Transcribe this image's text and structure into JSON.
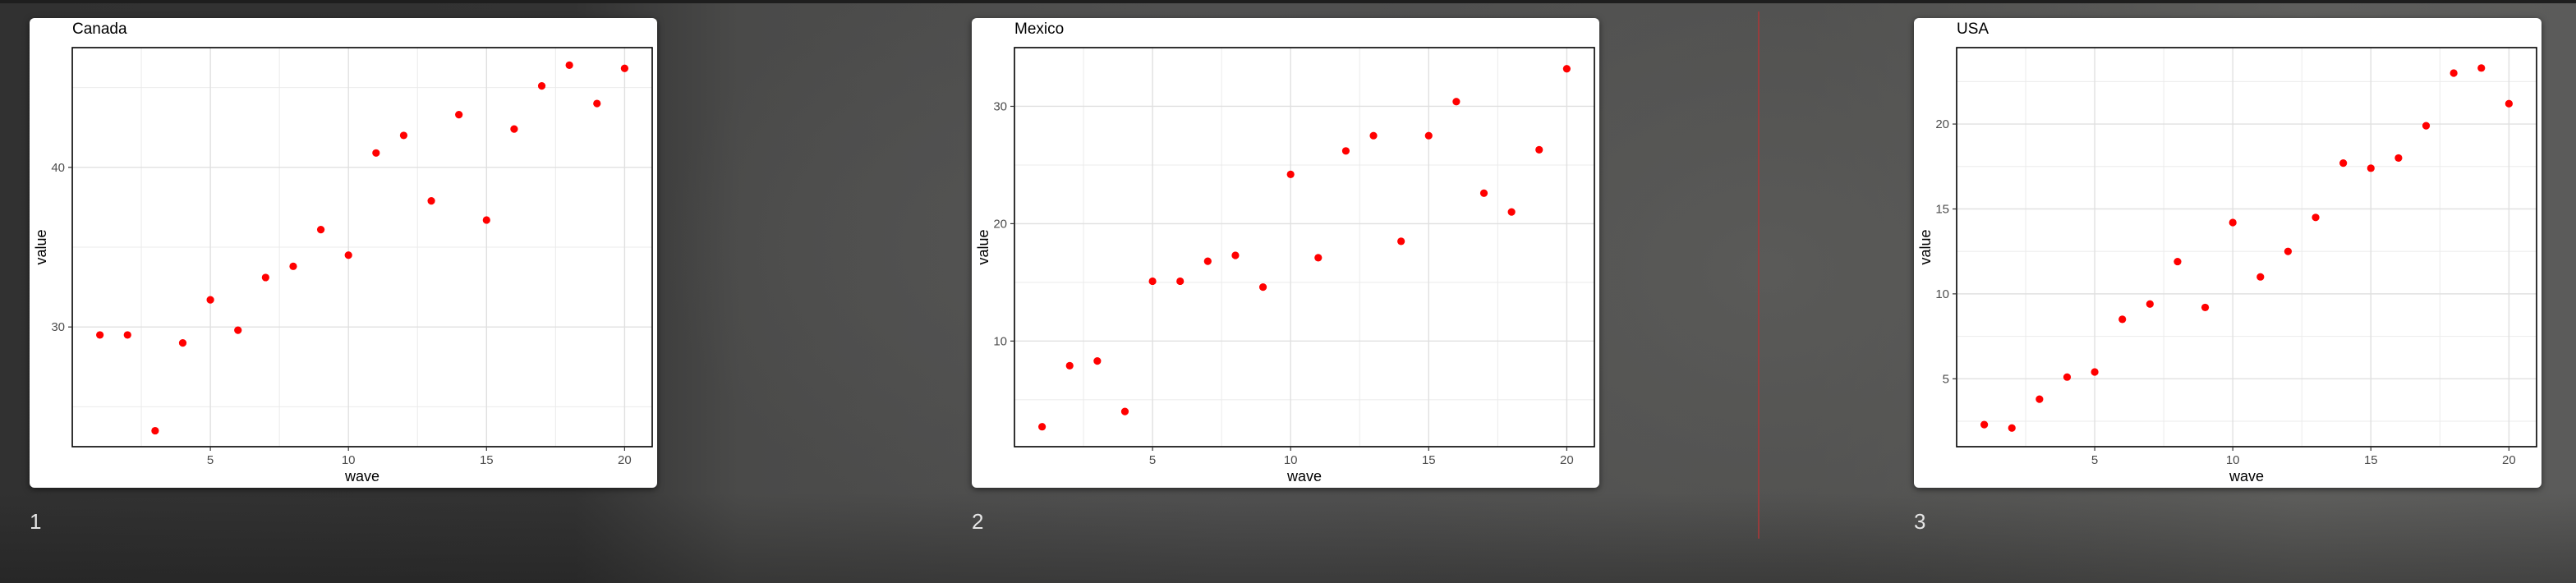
{
  "pages": [
    "1",
    "2",
    "3"
  ],
  "colors": {
    "point": "#ff0000",
    "grid": "#ebebeb",
    "frame": "#000000"
  },
  "chart_data": [
    {
      "type": "scatter",
      "title": "Canada",
      "xlabel": "wave",
      "ylabel": "value",
      "xlim": [
        0,
        21
      ],
      "ylim": [
        22.5,
        47.5
      ],
      "xticks": [
        5,
        10,
        15,
        20
      ],
      "yticks": [
        30,
        40
      ],
      "grid": true,
      "x": [
        1,
        2,
        3,
        4,
        5,
        6,
        7,
        8,
        9,
        10,
        11,
        12,
        13,
        14,
        15,
        16,
        17,
        18,
        19,
        20
      ],
      "y": [
        29.5,
        29.5,
        23.5,
        29.0,
        31.7,
        29.8,
        33.1,
        33.8,
        36.1,
        34.5,
        40.9,
        42.0,
        37.9,
        43.3,
        36.7,
        42.4,
        45.1,
        46.4,
        44.0,
        46.2
      ]
    },
    {
      "type": "scatter",
      "title": "Mexico",
      "xlabel": "wave",
      "ylabel": "value",
      "xlim": [
        0,
        21
      ],
      "ylim": [
        1.0,
        35.0
      ],
      "xticks": [
        5,
        10,
        15,
        20
      ],
      "yticks": [
        10,
        20,
        30
      ],
      "grid": true,
      "x": [
        1,
        2,
        3,
        4,
        5,
        6,
        7,
        8,
        9,
        10,
        11,
        12,
        13,
        14,
        15,
        16,
        17,
        18,
        19,
        20
      ],
      "y": [
        2.7,
        7.9,
        8.3,
        4.0,
        15.1,
        15.1,
        16.8,
        17.3,
        14.6,
        24.2,
        17.1,
        26.2,
        27.5,
        18.5,
        27.5,
        30.4,
        22.6,
        21.0,
        26.3,
        33.2
      ]
    },
    {
      "type": "scatter",
      "title": "USA",
      "xlabel": "wave",
      "ylabel": "value",
      "xlim": [
        0,
        21
      ],
      "ylim": [
        1.0,
        24.5
      ],
      "xticks": [
        5,
        10,
        15,
        20
      ],
      "yticks": [
        5,
        10,
        15,
        20
      ],
      "grid": true,
      "x": [
        1,
        2,
        3,
        4,
        5,
        6,
        7,
        8,
        9,
        10,
        11,
        12,
        13,
        14,
        15,
        16,
        17,
        18,
        19,
        20
      ],
      "y": [
        2.3,
        2.1,
        3.8,
        5.1,
        5.4,
        8.5,
        9.4,
        11.9,
        9.2,
        14.2,
        11.0,
        12.5,
        14.5,
        17.7,
        17.4,
        18.0,
        19.9,
        23.0,
        23.3,
        21.2
      ]
    }
  ]
}
